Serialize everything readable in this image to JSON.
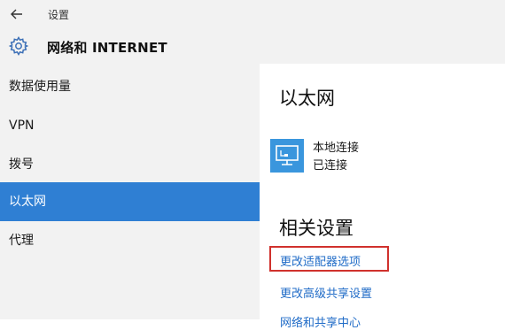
{
  "window": {
    "title": "设置"
  },
  "header": {
    "title": "网络和 INTERNET"
  },
  "sidebar": {
    "items": [
      {
        "label": "数据使用量",
        "active": false
      },
      {
        "label": "VPN",
        "active": false
      },
      {
        "label": "拨号",
        "active": false
      },
      {
        "label": "以太网",
        "active": true
      },
      {
        "label": "代理",
        "active": false
      }
    ]
  },
  "main": {
    "section_title": "以太网",
    "connection": {
      "name": "本地连接",
      "status": "已连接"
    },
    "related_title": "相关设置",
    "links": [
      "更改适配器选项",
      "更改高级共享设置",
      "网络和共享中心"
    ]
  },
  "colors": {
    "accent": "#2f7fd3",
    "link": "#1f6bc7",
    "highlight": "#d0312d",
    "icon_tile": "#3a96dd"
  }
}
